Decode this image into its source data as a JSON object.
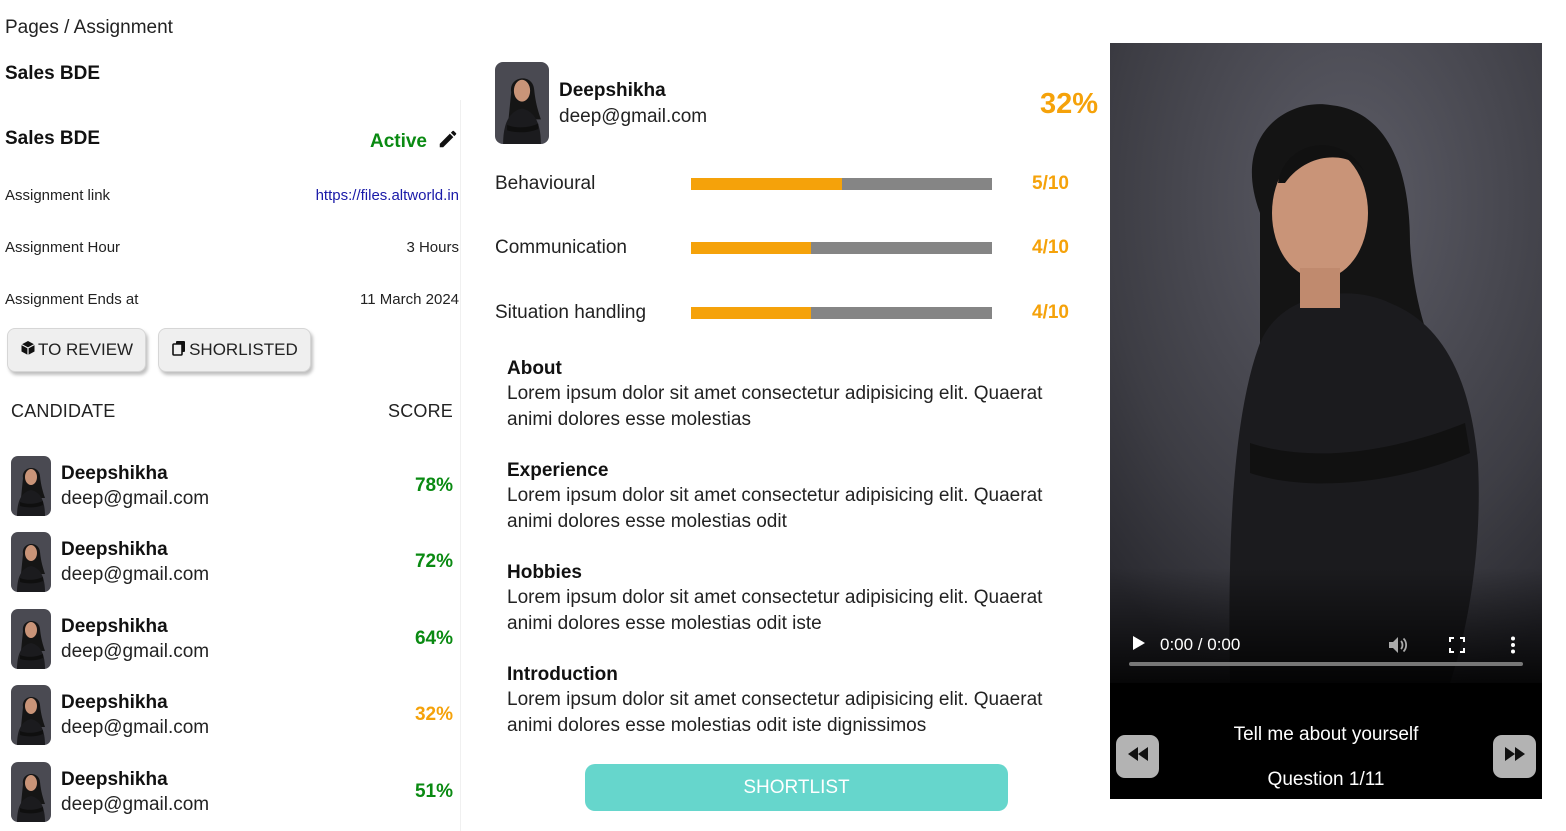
{
  "breadcrumb": "Pages / Assignment",
  "job": {
    "title_top": "Sales BDE",
    "title": "Sales BDE",
    "status": "Active",
    "edit_icon": "pencil-icon",
    "assignment_link_label": "Assignment link",
    "assignment_link": "https://files.altworld.in",
    "assignment_hour_label": "Assignment Hour",
    "assignment_hour": "3 Hours",
    "assignment_ends_label": "Assignment Ends at",
    "assignment_ends": "11 March 2024"
  },
  "tabs": [
    {
      "label": "TO REVIEW",
      "icon": "cube-icon"
    },
    {
      "label": "SHORLISTED",
      "icon": "copy-icon"
    }
  ],
  "list": {
    "col_candidate": "CANDIDATE",
    "col_score": "SCORE",
    "candidates": [
      {
        "name": "Deepshikha",
        "email": "deep@gmail.com",
        "score": "78%",
        "score_color": "#0a8a12"
      },
      {
        "name": "Deepshikha",
        "email": "deep@gmail.com",
        "score": "72%",
        "score_color": "#0a8a12"
      },
      {
        "name": "Deepshikha",
        "email": "deep@gmail.com",
        "score": "64%",
        "score_color": "#0a8a12"
      },
      {
        "name": "Deepshikha",
        "email": "deep@gmail.com",
        "score": "32%",
        "score_color": "#f5a20a"
      },
      {
        "name": "Deepshikha",
        "email": "deep@gmail.com",
        "score": "51%",
        "score_color": "#0a8a12"
      }
    ]
  },
  "profile": {
    "name": "Deepshikha",
    "email": "deep@gmail.com",
    "score": "32%",
    "metrics": [
      {
        "label": "Behavioural",
        "value": "5/10",
        "fraction": 0.5
      },
      {
        "label": "Communication",
        "value": "4/10",
        "fraction": 0.4
      },
      {
        "label": "Situation handling",
        "value": "4/10",
        "fraction": 0.4
      }
    ],
    "sections": [
      {
        "heading": "About",
        "body": "Lorem ipsum dolor sit amet consectetur adipisicing elit. Quaerat animi dolores esse molestias"
      },
      {
        "heading": "Experience",
        "body": "Lorem ipsum dolor sit amet consectetur adipisicing elit. Quaerat animi dolores esse molestias odit"
      },
      {
        "heading": "Hobbies",
        "body": "Lorem ipsum dolor sit amet consectetur adipisicing elit. Quaerat animi dolores esse molestias odit iste"
      },
      {
        "heading": "Introduction",
        "body": "Lorem ipsum dolor sit amet consectetur adipisicing elit. Quaerat animi dolores esse molestias odit iste dignissimos"
      }
    ],
    "shortlist_label": "SHORTLIST"
  },
  "video": {
    "time": "0:00 / 0:00",
    "progress": 0,
    "question_text": "Tell me about yourself",
    "question_counter": "Question 1/11",
    "colors": {
      "accent": "#f5a20a",
      "active": "#0a8a12",
      "button": "#66d6cc"
    }
  }
}
